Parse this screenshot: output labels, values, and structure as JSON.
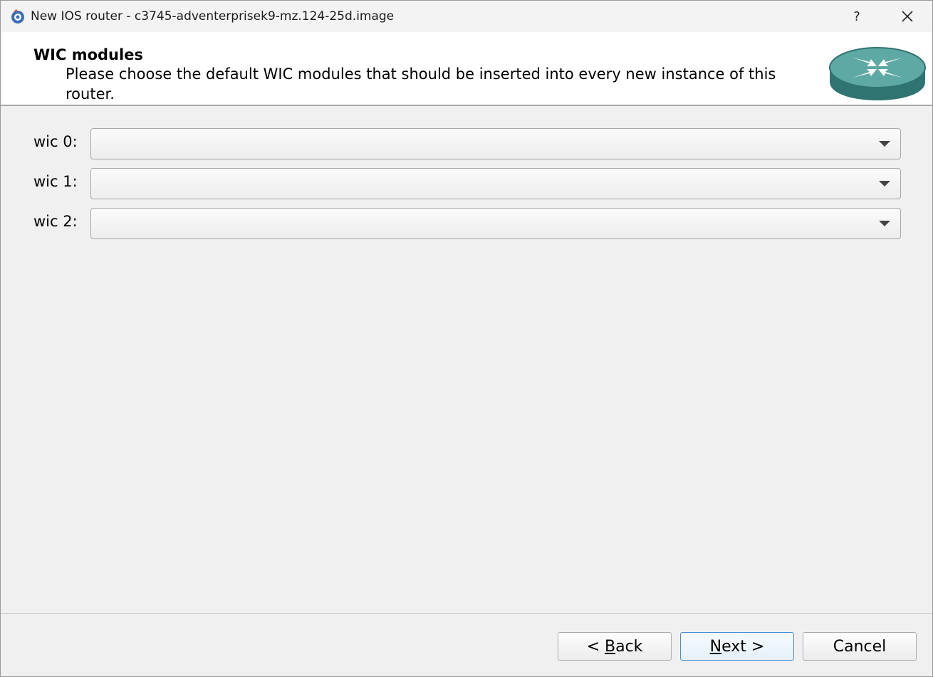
{
  "window": {
    "title": "New IOS router - c3745-adventerprisek9-mz.124-25d.image",
    "help_label": "?",
    "close_label": "✕"
  },
  "header": {
    "title": "WIC modules",
    "subtitle": "Please choose the default WIC modules that should be inserted into every new instance of this router.",
    "logo_icon": "router-icon"
  },
  "wic_slots": [
    {
      "label": "wic 0:",
      "value": ""
    },
    {
      "label": "wic 1:",
      "value": ""
    },
    {
      "label": "wic 2:",
      "value": ""
    }
  ],
  "buttons": {
    "back_chevron": "<",
    "back_mnemonic": "B",
    "back_rest": "ack",
    "next_mnemonic": "N",
    "next_rest": "ext",
    "next_chevron": ">",
    "cancel": "Cancel"
  },
  "colors": {
    "router_body": "#3c8a86",
    "router_top": "#5fa9a4",
    "focus_border": "#4a8fd6"
  }
}
